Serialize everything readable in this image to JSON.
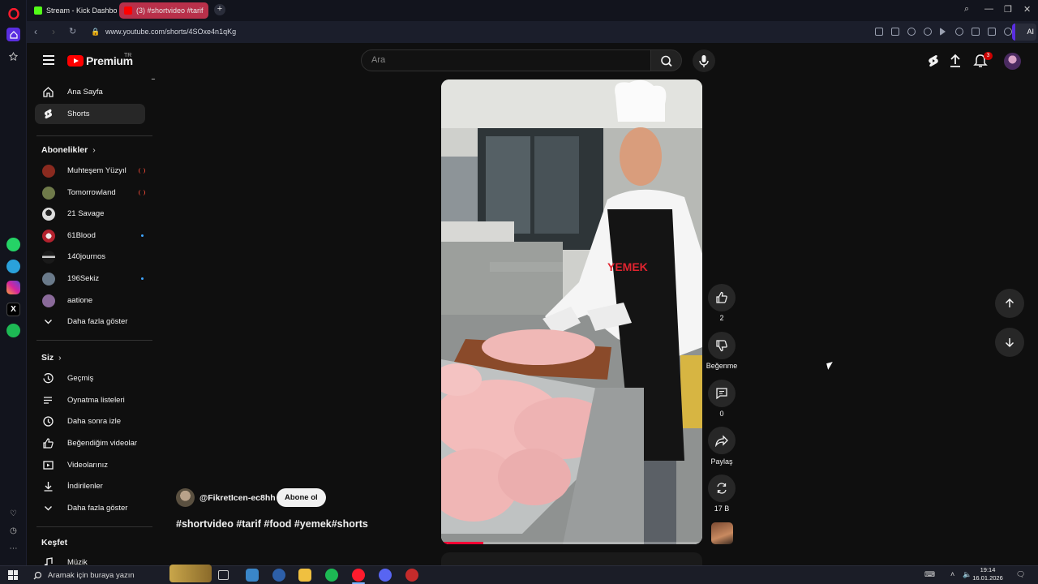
{
  "browser": {
    "tabs": [
      {
        "title": "Stream - Kick Dashboard",
        "active": false
      },
      {
        "title": "(3) #shortvideo #tarif",
        "active": true
      }
    ],
    "url": "www.youtube.com/shorts/4SOxe4n1qKg",
    "ai_label": "AI"
  },
  "header": {
    "logo_text": "Premium",
    "region": "TR",
    "search_placeholder": "Ara",
    "notification_count": "3"
  },
  "sidebar": {
    "main": [
      {
        "label": "Ana Sayfa",
        "icon": "home-icon"
      },
      {
        "label": "Shorts",
        "icon": "shorts-icon",
        "active": true
      }
    ],
    "subscriptions_heading": "Abonelikler",
    "subscriptions": [
      {
        "label": "Muhteşem Yüzyıl",
        "status": "live",
        "color": "#8a2a1f"
      },
      {
        "label": "Tomorrowland",
        "status": "live",
        "color": "#6f7a4a"
      },
      {
        "label": "21 Savage",
        "status": "",
        "color": "#dcdcdc"
      },
      {
        "label": "61Blood",
        "status": "new",
        "color": "#b3222e"
      },
      {
        "label": "140journos",
        "status": "",
        "color": "#1a1a1a"
      },
      {
        "label": "196Sekiz",
        "status": "new",
        "color": "#6a7a8a"
      },
      {
        "label": "aatione",
        "status": "",
        "color": "#8a6a9a"
      }
    ],
    "show_more_subs": "Daha fazla göster",
    "you_heading": "Siz",
    "you_items": [
      {
        "label": "Geçmiş",
        "icon": "history-icon"
      },
      {
        "label": "Oynatma listeleri",
        "icon": "playlist-icon"
      },
      {
        "label": "Daha sonra izle",
        "icon": "clock-icon"
      },
      {
        "label": "Beğendiğim videolar",
        "icon": "like-icon"
      },
      {
        "label": "Videolarınız",
        "icon": "video-icon"
      },
      {
        "label": "İndirilenler",
        "icon": "download-icon"
      }
    ],
    "show_more_you": "Daha fazla göster",
    "explore_heading": "Keşfet",
    "explore_items": [
      {
        "label": "Müzik"
      }
    ]
  },
  "short": {
    "channel": "@FikretIcen-ec8hh",
    "subscribe_label": "Abone ol",
    "title": "#shortvideo #tarif #food #yemek#shorts",
    "apron_text": "YEMEK",
    "progress_fraction": 0.16,
    "actions": {
      "likes": "2",
      "dislike_label": "Beğenme",
      "comments": "0",
      "share_label": "Paylaş",
      "remix_count": "17 B"
    }
  },
  "taskbar": {
    "search_placeholder": "Aramak için buraya yazın",
    "time": "19:14",
    "date": "16.01.2026"
  }
}
